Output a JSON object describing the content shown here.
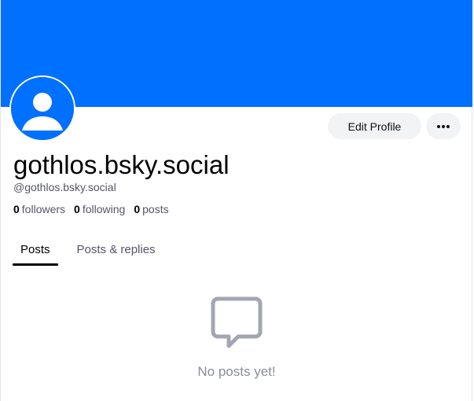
{
  "profile": {
    "display_name": "gothlos.bsky.social",
    "handle": "@gothlos.bsky.social"
  },
  "actions": {
    "edit_profile_label": "Edit Profile",
    "more_icon": "ellipsis-icon"
  },
  "stats": {
    "followers_count": "0",
    "followers_label": "followers",
    "following_count": "0",
    "following_label": "following",
    "posts_count": "0",
    "posts_label": "posts"
  },
  "tabs": [
    {
      "label": "Posts",
      "active": true
    },
    {
      "label": "Posts & replies",
      "active": false
    }
  ],
  "feed": {
    "empty_icon": "message-bubble-icon",
    "empty_message": "No posts yet!"
  },
  "colors": {
    "banner": "#0070ff",
    "avatar_bg": "#0070ff",
    "button_bg": "#f1f3f5",
    "muted_text": "#545664",
    "empty_text": "#8a8d99"
  }
}
